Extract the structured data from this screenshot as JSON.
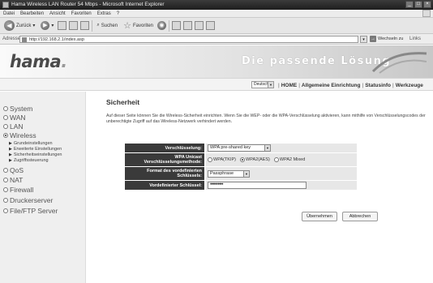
{
  "window": {
    "title": "Hama Wireless LAN Router 54 Mbps - Microsoft Internet Explorer",
    "controls": [
      "_",
      "□",
      "×"
    ]
  },
  "menu": [
    "Datei",
    "Bearbeiten",
    "Ansicht",
    "Favoriten",
    "Extras",
    "?"
  ],
  "toolbar": {
    "back_label": "Zurück",
    "search_label": "Suchen",
    "favorites_label": "Favoriten"
  },
  "address": {
    "label": "Adresse",
    "url": "http://192.168.2.1/index.asp",
    "go_label": "Wechseln zu",
    "links_label": "Links"
  },
  "header": {
    "logo": "hama",
    "slogan": "Die passende Lösung"
  },
  "nav": {
    "language": "Deutsch",
    "links": [
      "HOME",
      "Allgemeine Einrichtung",
      "Statusinfo",
      "Werkzeuge"
    ]
  },
  "sidebar": {
    "items": [
      {
        "label": "System",
        "selected": false
      },
      {
        "label": "WAN",
        "selected": false
      },
      {
        "label": "LAN",
        "selected": false
      },
      {
        "label": "Wireless",
        "selected": true
      },
      {
        "label": "QoS",
        "selected": false
      },
      {
        "label": "NAT",
        "selected": false
      },
      {
        "label": "Firewall",
        "selected": false
      },
      {
        "label": "Druckerserver",
        "selected": false
      },
      {
        "label": "File/FTP Server",
        "selected": false
      }
    ],
    "subitems": [
      "Grundeinstellungen",
      "Erweiterte Einstellungen",
      "Sicherheitseinstellungen",
      "Zugriffssteuerung"
    ]
  },
  "main": {
    "title": "Sicherheit",
    "description": "Auf dieser Seite können Sie die Wireless-Sicherheit einrichten. Wenn Sie die WEP- oder die WPA-Verschlüsselung aktivieren, kann mithilfe von Verschlüsselungscodes der unberechtigte Zugriff auf das Wireless-Netzwerk verhindert werden.",
    "form": {
      "encryption_label": "Verschlüsselung:",
      "encryption_value": "WPA pre-shared key",
      "wpa_label_line1": "WPA Unicast",
      "wpa_label_line2": "Verschlüsselungsmethode:",
      "wpa_options": [
        "WPA(TKIP)",
        "WPA2(AES)",
        "WPA2 Mixed"
      ],
      "wpa_selected": 1,
      "key_format_label_line1": "Format des vordefinierten",
      "key_format_label_line2": "Schlüssels:",
      "key_format_value": "Passphrase",
      "key_label": "Vordefinierter Schlüssel:",
      "key_value": "••••••••••"
    },
    "buttons": {
      "apply": "Übernehmen",
      "cancel": "Abbrechen"
    }
  }
}
